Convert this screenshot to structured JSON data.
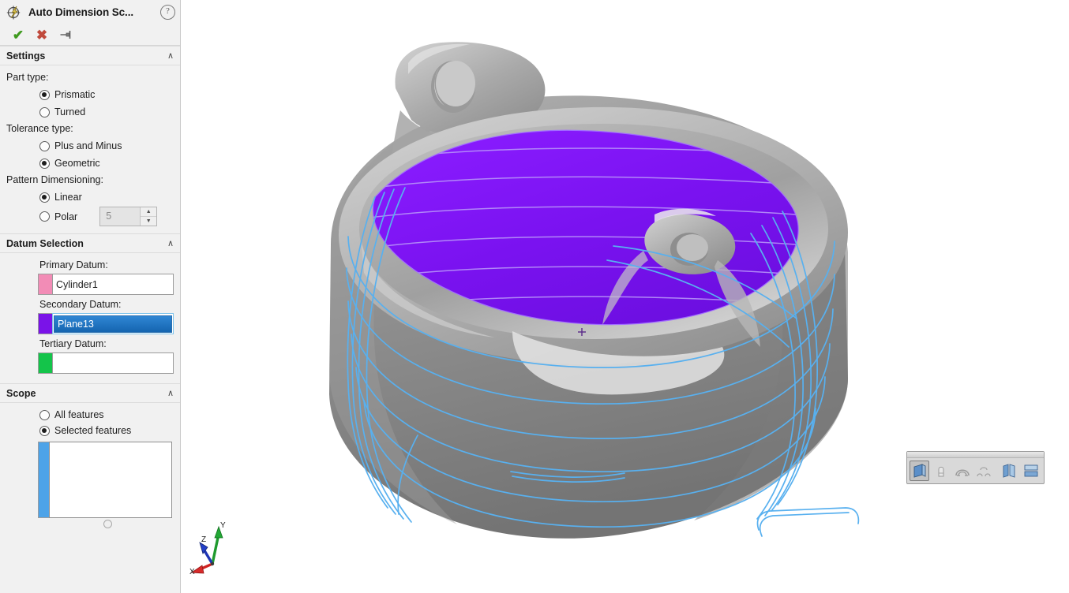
{
  "panel": {
    "title": "Auto Dimension Sc...",
    "title_icon": "auto-dimension-scheme-icon",
    "help_icon": "help-question-icon",
    "actions": {
      "ok_label": "✔",
      "ok_name": "ok-check-icon",
      "cancel_label": "✖",
      "cancel_name": "cancel-x-icon",
      "pin_label": "➤",
      "pin_name": "pin-icon"
    },
    "sections": {
      "settings": {
        "header": "Settings",
        "collapse_glyph": "∧",
        "part_type": {
          "label": "Part type:",
          "options": [
            {
              "label": "Prismatic",
              "selected": true
            },
            {
              "label": "Turned",
              "selected": false
            }
          ]
        },
        "tolerance_type": {
          "label": "Tolerance type:",
          "options": [
            {
              "label": "Plus and Minus",
              "selected": false
            },
            {
              "label": "Geometric",
              "selected": true
            }
          ]
        },
        "pattern_dimensioning": {
          "label": "Pattern Dimensioning:",
          "options": [
            {
              "label": "Linear",
              "selected": true
            },
            {
              "label": "Polar",
              "selected": false
            }
          ],
          "polar_count": "5",
          "spin_up": "▲",
          "spin_down": "▼"
        }
      },
      "datum_selection": {
        "header": "Datum Selection",
        "collapse_glyph": "∧",
        "rows": [
          {
            "label": "Primary Datum:",
            "value": "Cylinder1",
            "swatch": "#f28cb6",
            "selected": false
          },
          {
            "label": "Secondary Datum:",
            "value": "Plane13",
            "swatch": "#7a13e8",
            "selected": true
          },
          {
            "label": "Tertiary Datum:",
            "value": "",
            "swatch": "#14c44a",
            "selected": false
          }
        ]
      },
      "scope": {
        "header": "Scope",
        "collapse_glyph": "∧",
        "options": [
          {
            "label": "All features",
            "selected": false
          },
          {
            "label": "Selected features",
            "selected": true
          }
        ],
        "list_items": [],
        "strip_color": "#4da3e8"
      }
    }
  },
  "viewport": {
    "background": "#ffffff",
    "model": {
      "body_color": "#8e8e8e",
      "highlight_face_color": "#7a12f0",
      "curve_color": "#58b0ef",
      "selected_face_name": "Plane13"
    },
    "axis_triad": {
      "x_label": "X",
      "y_label": "Y",
      "z_label": "Z",
      "x_color": "#cf2222",
      "y_color": "#1f9a2e",
      "z_color": "#1f35b5"
    },
    "view_toolbar": {
      "buttons": [
        {
          "name": "section-view-icon",
          "active": true
        },
        {
          "name": "draft-analysis-icon",
          "active": false
        },
        {
          "name": "undercut-analysis-icon",
          "active": false
        },
        {
          "name": "parting-line-analysis-icon",
          "active": false
        },
        {
          "name": "zebra-stripes-icon",
          "active": false
        },
        {
          "name": "curvature-display-icon",
          "active": false
        }
      ]
    }
  }
}
